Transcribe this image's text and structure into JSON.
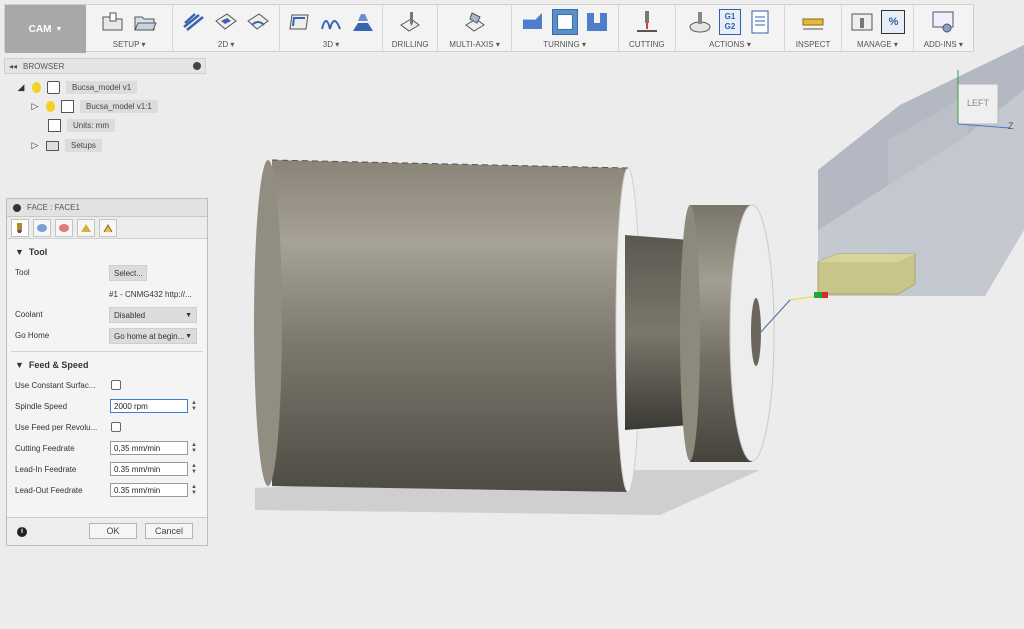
{
  "toolbar": {
    "workspace": "CAM",
    "groups": [
      {
        "label": "SETUP ▾"
      },
      {
        "label": "2D ▾"
      },
      {
        "label": "3D ▾"
      },
      {
        "label": "DRILLING"
      },
      {
        "label": "MULTI-AXIS ▾"
      },
      {
        "label": "TURNING ▾"
      },
      {
        "label": "CUTTING"
      },
      {
        "label": "ACTIONS ▾"
      },
      {
        "label": "INSPECT"
      },
      {
        "label": "MANAGE ▾"
      },
      {
        "label": "ADD-INS ▾"
      }
    ],
    "g_code_line1": "G1",
    "g_code_line2": "G2",
    "percent": "%"
  },
  "browser": {
    "title": "BROWSER",
    "items": [
      {
        "label": "Bucsa_model v1"
      },
      {
        "label": "Bucsa_model v1:1"
      },
      {
        "label": "Units: mm"
      },
      {
        "label": "Setups"
      }
    ]
  },
  "dialog": {
    "title": "FACE : FACE1",
    "tool_section": "Tool",
    "tool_label": "Tool",
    "tool_select": "Select...",
    "tool_desc": "#1 - CNMG432 http://...",
    "coolant_label": "Coolant",
    "coolant_value": "Disabled",
    "gohome_label": "Go Home",
    "gohome_value": "Go home at begin...",
    "feed_section": "Feed & Speed",
    "constant_surface_label": "Use Constant Surfac...",
    "spindle_label": "Spindle Speed",
    "spindle_value": "2000 rpm",
    "feed_per_rev_label": "Use Feed per Revolu...",
    "cutting_label": "Cutting Feedrate",
    "cutting_value": "0,35 mm/min",
    "leadin_label": "Lead-In Feedrate",
    "leadin_value": "0.35 mm/min",
    "leadout_label": "Lead-Out Feedrate",
    "leadout_value": "0.35 mm/min",
    "ok": "OK",
    "cancel": "Cancel"
  },
  "viewcube": {
    "face": "LEFT",
    "axis": "Z"
  },
  "colors": {
    "accent": "#3c7fd1",
    "toolbar_active": "#5b8fc9",
    "stock": "#c8c48a"
  }
}
